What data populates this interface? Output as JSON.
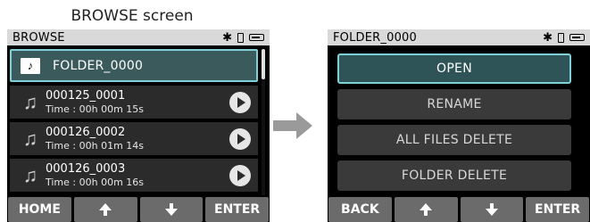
{
  "caption": "BROWSE screen",
  "left_screen": {
    "title": "BROWSE",
    "status_icons": [
      "bluetooth-icon",
      "phone-icon",
      "battery-icon"
    ],
    "folder": {
      "label": "FOLDER_0000"
    },
    "files": [
      {
        "name": "000125_0001",
        "time": "Time : 00h 00m 15s"
      },
      {
        "name": "000126_0002",
        "time": "Time : 00h 01m 14s"
      },
      {
        "name": "000126_0003",
        "time": "Time : 00h 00m 16s"
      }
    ],
    "buttons": {
      "home": "HOME",
      "enter": "ENTER"
    }
  },
  "right_screen": {
    "title": "FOLDER_0000",
    "menu": [
      "OPEN",
      "RENAME",
      "ALL FILES DELETE",
      "FOLDER DELETE"
    ],
    "buttons": {
      "back": "BACK",
      "enter": "ENTER"
    }
  },
  "colors": {
    "selected_border": "#7fd0d8",
    "selected_fill": "#2e5457",
    "button_gray": "#6b6b6b"
  }
}
